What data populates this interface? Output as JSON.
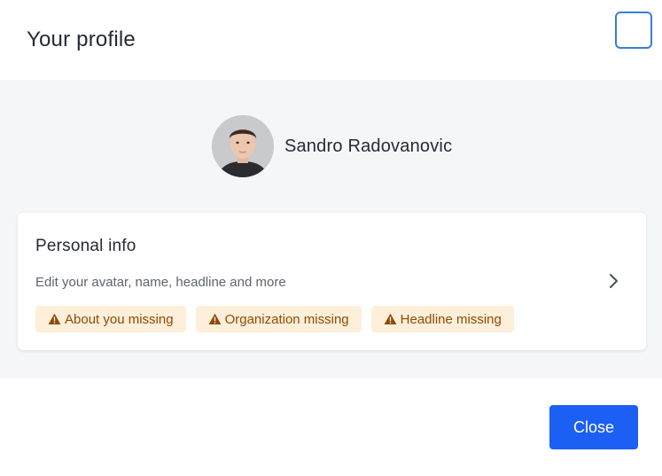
{
  "modal": {
    "title": "Your profile"
  },
  "profile": {
    "name": "Sandro Radovanovic"
  },
  "personal_info": {
    "title": "Personal info",
    "subtitle": "Edit your avatar, name, headline and more",
    "badges": [
      {
        "label": "About you missing",
        "icon": "warning-icon"
      },
      {
        "label": "Organization missing",
        "icon": "warning-icon"
      },
      {
        "label": "Headline missing",
        "icon": "warning-icon"
      }
    ]
  },
  "footer": {
    "close_label": "Close"
  },
  "colors": {
    "primary": "#1c5ff5",
    "badge_bg": "#fdefd9",
    "badge_text": "#8f4a06",
    "body_bg": "#f5f6f8",
    "focus_outline": "#3b7be0"
  }
}
